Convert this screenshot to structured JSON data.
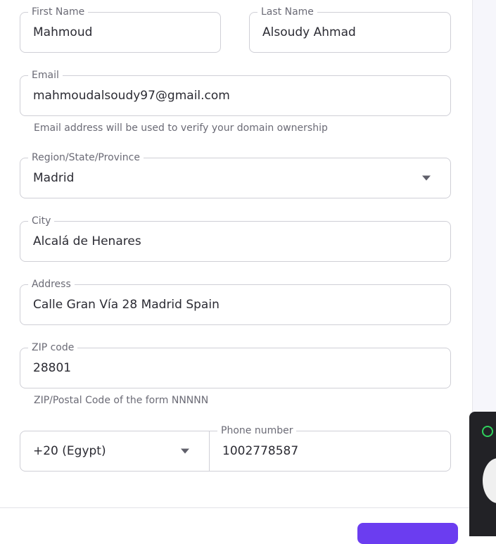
{
  "form": {
    "first_name": {
      "label": "First Name",
      "value": "Mahmoud"
    },
    "last_name": {
      "label": "Last Name",
      "value": "Alsoudy Ahmad"
    },
    "email": {
      "label": "Email",
      "value": "mahmoudalsoudy97@gmail.com",
      "helper": "Email address will be used to verify your domain ownership"
    },
    "region": {
      "label": "Region/State/Province",
      "value": "Madrid"
    },
    "city": {
      "label": "City",
      "value": "Alcalá de Henares"
    },
    "address": {
      "label": "Address",
      "value": "Calle Gran Vía 28 Madrid Spain"
    },
    "zip": {
      "label": "ZIP code",
      "value": "28801",
      "helper": "ZIP/Postal Code of the form NNNNN"
    },
    "country_code": {
      "value": "+20 (Egypt)"
    },
    "phone": {
      "label": "Phone number",
      "value": "1002778587"
    }
  },
  "icons": {
    "dropdown": "chevron-down-icon",
    "chat": "whatsapp-icon"
  },
  "colors": {
    "primary_button": "#6b3df0",
    "whatsapp": "#2fd15c"
  }
}
